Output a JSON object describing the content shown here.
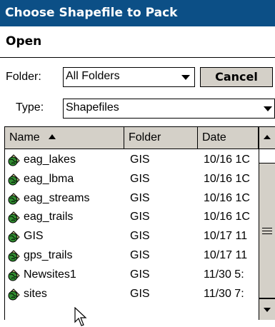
{
  "window": {
    "title": "Choose Shapefile to Pack"
  },
  "toolbar": {
    "open_label": "Open"
  },
  "folder": {
    "label": "Folder:",
    "value": "All Folders"
  },
  "cancel_label": "Cancel",
  "type": {
    "label": "Type:",
    "value": "Shapefiles"
  },
  "columns": {
    "name": "Name",
    "folder": "Folder",
    "date": "Date",
    "sort": "ascending"
  },
  "files": [
    {
      "name": "eag_lakes",
      "folder": "GIS",
      "date": "10/16 1C"
    },
    {
      "name": "eag_lbma",
      "folder": "GIS",
      "date": "10/16 1C"
    },
    {
      "name": "eag_streams",
      "folder": "GIS",
      "date": "10/16 1C"
    },
    {
      "name": "eag_trails",
      "folder": "GIS",
      "date": "10/16 1C"
    },
    {
      "name": "GIS",
      "folder": "GIS",
      "date": "10/17 11"
    },
    {
      "name": "gps_trails",
      "folder": "GIS",
      "date": "10/17 11"
    },
    {
      "name": "Newsites1",
      "folder": "GIS",
      "date": "11/30 5:"
    },
    {
      "name": "sites",
      "folder": "GIS",
      "date": "11/30 7:"
    }
  ],
  "icons": {
    "file": "shapefile-globe-icon",
    "cursor": "mouse-pointer-icon"
  },
  "colors": {
    "titlebar": "#0c4f86",
    "chrome": "#d4d0c8",
    "icon_green": "#2f8b2f"
  }
}
